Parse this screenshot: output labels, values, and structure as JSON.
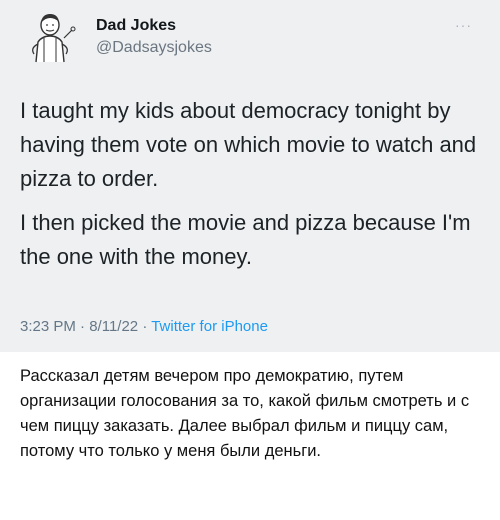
{
  "tweet": {
    "author_name": "Dad Jokes",
    "author_handle": "@Dadsaysjokes",
    "more_label": "···",
    "paragraph_1": "I taught my kids about democracy tonight by having them vote on which movie to watch and pizza to order.",
    "paragraph_2": "I then picked the movie and pizza because I'm the one with the money.",
    "time": "3:23 PM",
    "separator_1": " · ",
    "date": "8/11/22",
    "separator_2": " · ",
    "source": "Twitter for iPhone"
  },
  "translation": {
    "text": "Рассказал детям вечером про демократию, путем организации голосования за то, какой фильм смотреть и с чем пиццу заказать. Далее выбрал фильм и пиццу сам, потому что только у меня были деньги."
  },
  "colors": {
    "tweet_background": "#eef0f2",
    "link_blue": "#1d9bf0",
    "meta_gray": "#657786"
  }
}
